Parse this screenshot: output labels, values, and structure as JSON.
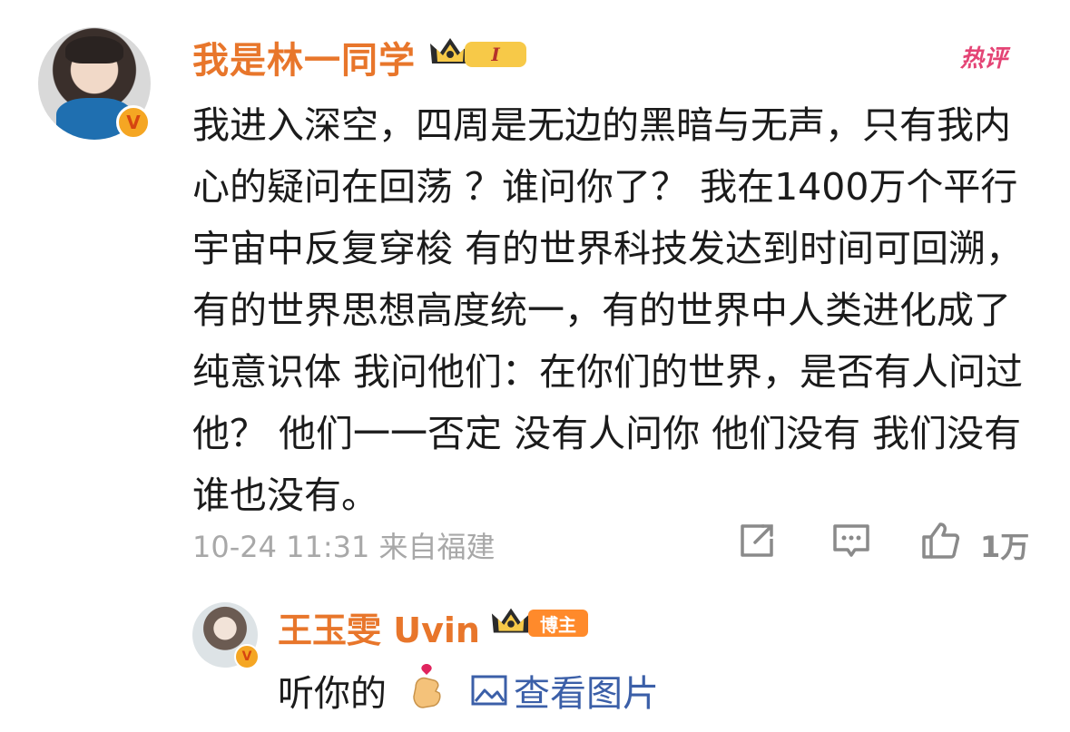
{
  "comment": {
    "username": "我是林一同学",
    "level": "I",
    "hot_label": "热评",
    "text": "我进入深空，四周是无边的黑暗与无声，只有我内心的疑问在回荡 ？谁问你了？ 我在1400万个平行宇宙中反复穿梭 有的世界科技发达到时间可回溯，有的世界思想高度统一，有的世界中人类进化成了纯意识体 我问他们：在你们的世界，是否有人问过他？ 他们一一否定 没有人问你 他们没有 我们没有 谁也没有。",
    "timestamp": "10-24 11:31",
    "location": "来自福建",
    "like_count": "1万",
    "icons": [
      "share-icon",
      "comment-icon",
      "like-icon"
    ]
  },
  "reply": {
    "username": "王玉雯 Uvin",
    "badge": "博主",
    "text": "听你的",
    "emoji": "finger-heart-emoji",
    "view_image_label": "查看图片"
  },
  "colors": {
    "username": "#e8762b",
    "link": "#3b5fa8",
    "meta": "#a8a8a8",
    "hot": "#e0245e"
  }
}
